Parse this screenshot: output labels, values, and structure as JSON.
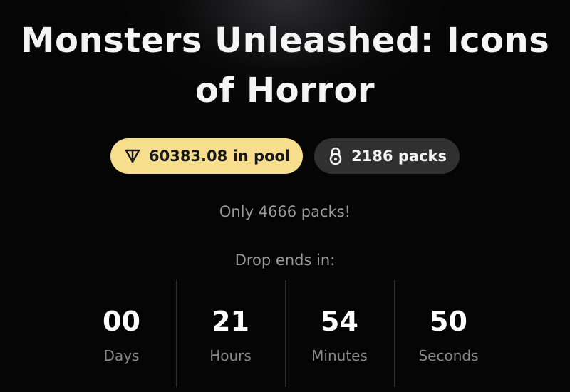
{
  "header": {
    "title_line1": "Monsters Unleashed: Icons",
    "title_line2": "of Horror"
  },
  "badges": {
    "pool": {
      "icon": "ton-triangle-icon",
      "label": "60383.08 in pool",
      "bg": "#f7de8c"
    },
    "packs": {
      "icon": "lock-icon",
      "label": "2186 packs",
      "bg": "#303030"
    }
  },
  "info": {
    "only_text": "Only 4666 packs!",
    "drop_label": "Drop ends in:"
  },
  "countdown": [
    {
      "value": "00",
      "unit": "Days"
    },
    {
      "value": "21",
      "unit": "Hours"
    },
    {
      "value": "54",
      "unit": "Minutes"
    },
    {
      "value": "50",
      "unit": "Seconds"
    }
  ]
}
